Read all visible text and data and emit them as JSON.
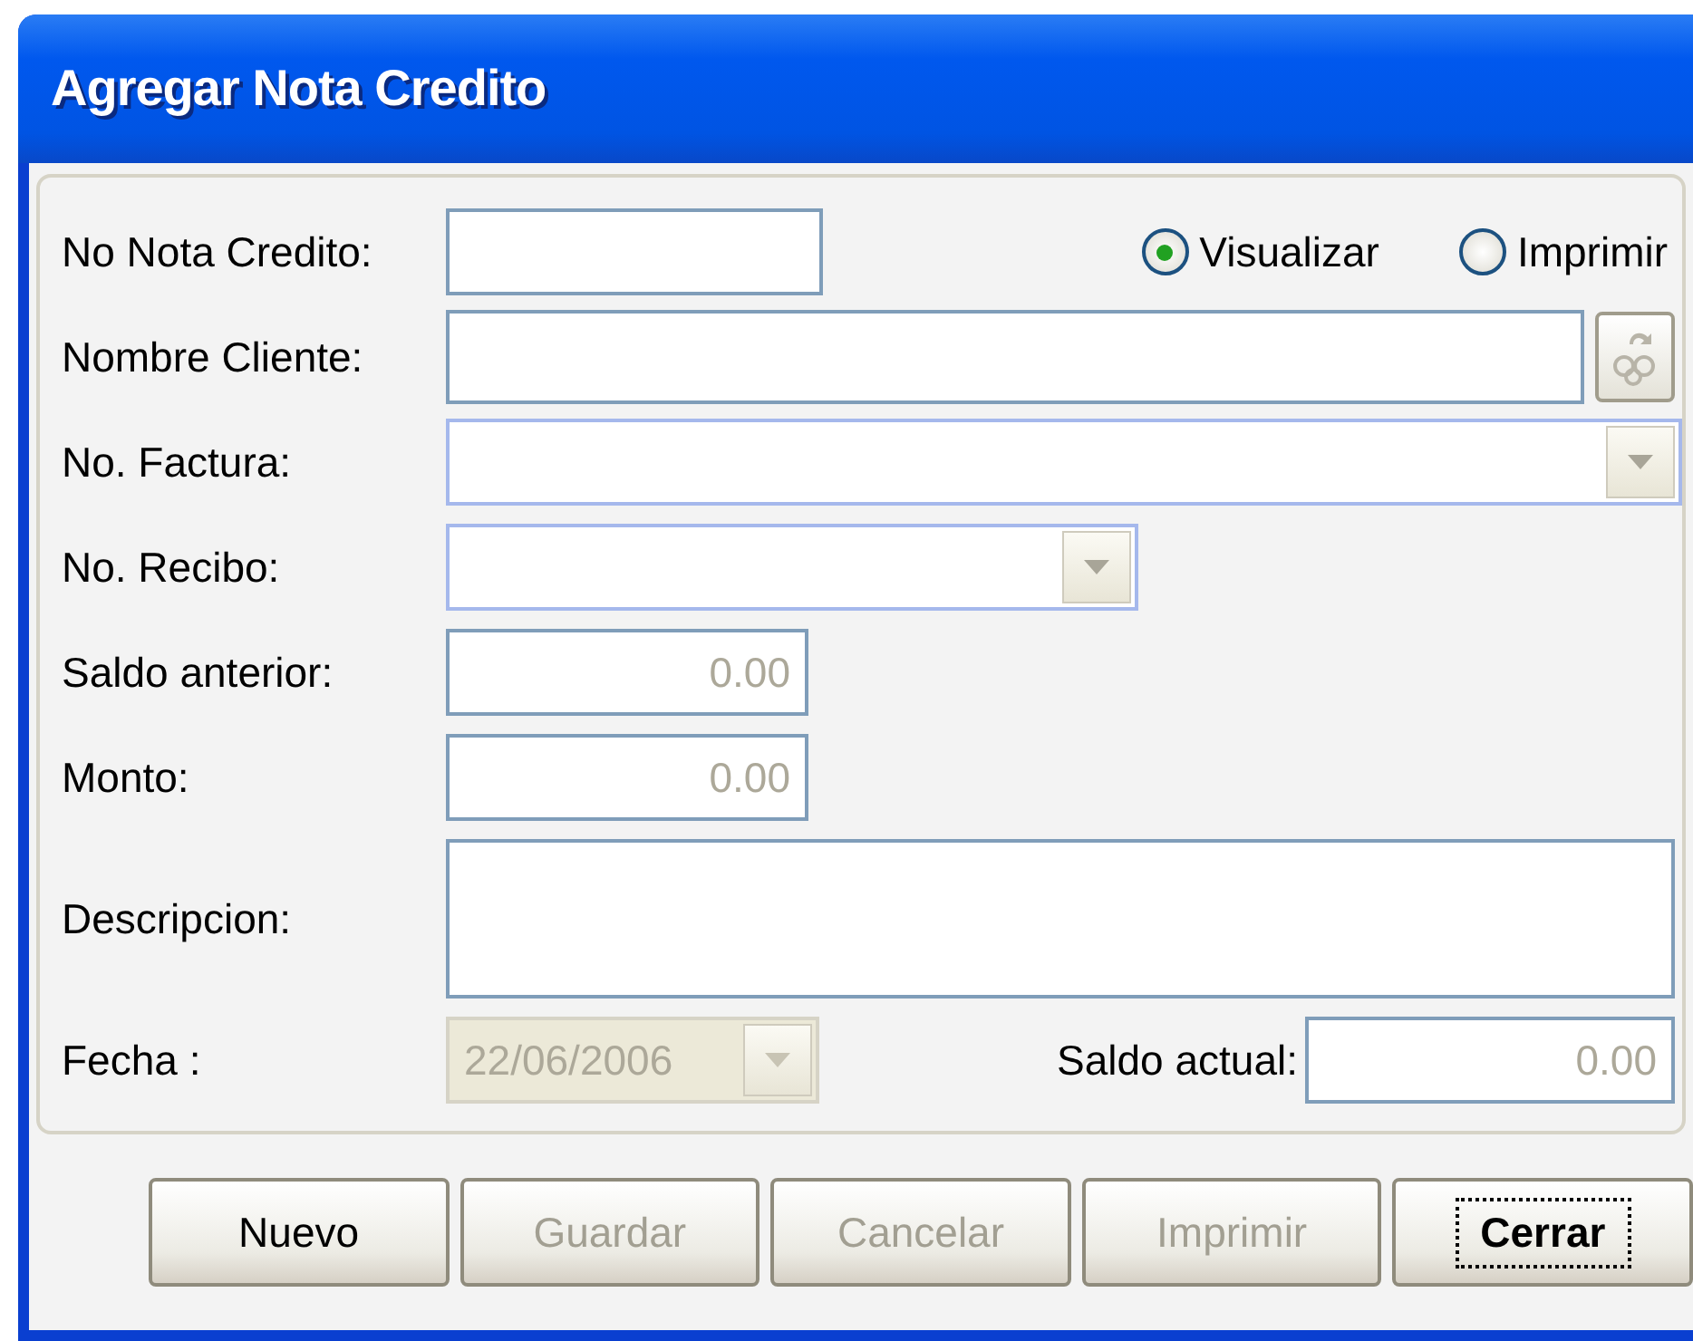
{
  "window": {
    "title": "Agregar Nota Credito"
  },
  "output_options": [
    {
      "label": "Visualizar",
      "selected": true
    },
    {
      "label": "Imprimir",
      "selected": false
    }
  ],
  "fields": [
    {
      "kind": "text",
      "label": "No Nota Credito:"
    },
    {
      "kind": "lookup",
      "label": "Nombre Cliente:"
    },
    {
      "kind": "combo",
      "label": "No. Factura:"
    },
    {
      "kind": "combo_short",
      "label": "No. Recibo:"
    },
    {
      "kind": "number",
      "label": "Saldo anterior:",
      "value": "0.00"
    },
    {
      "kind": "number",
      "label": "Monto:",
      "value": "0.00"
    },
    {
      "kind": "textarea",
      "label": "Descripcion:"
    },
    {
      "kind": "date",
      "label": "Fecha :",
      "value": "22/06/2006",
      "disabled": true
    }
  ],
  "balance": {
    "label": "Saldo actual:",
    "value": "0.00"
  },
  "buttons": [
    {
      "label": "Nuevo",
      "disabled": false,
      "focused": false
    },
    {
      "label": "Guardar",
      "disabled": true,
      "focused": false
    },
    {
      "label": "Cancelar",
      "disabled": true,
      "focused": false
    },
    {
      "label": "Imprimir",
      "disabled": true,
      "focused": false
    },
    {
      "label": "Cerrar",
      "disabled": false,
      "focused": true
    }
  ]
}
